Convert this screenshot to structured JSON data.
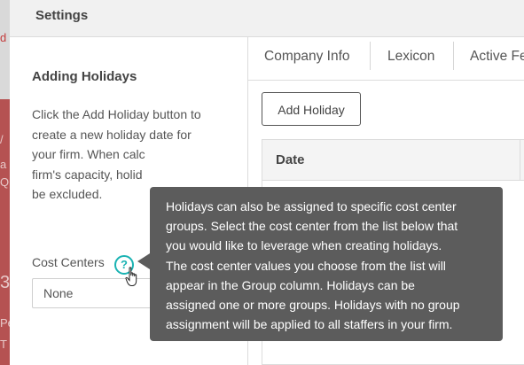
{
  "background": {
    "fragments": [
      "d",
      "/",
      "a",
      "Q",
      "3",
      "Pe",
      "T"
    ]
  },
  "panel": {
    "title": "Settings"
  },
  "left": {
    "section_title": "Adding Holidays",
    "description_lines": [
      "Click the Add Holiday button to",
      "create a new holiday date for",
      "your firm. When calc",
      "firm's capacity, holid",
      "be excluded."
    ],
    "cost_centers_label": "Cost Centers",
    "help_icon_glyph": "?",
    "cost_center_select_value": "None"
  },
  "tabs": [
    {
      "label": "Company Info"
    },
    {
      "label": "Lexicon"
    },
    {
      "label": "Active Fe"
    }
  ],
  "toolbar": {
    "add_holiday_label": "Add Holiday"
  },
  "table": {
    "columns": [
      "Date"
    ]
  },
  "tooltip": {
    "lines": [
      "Holidays can also be assigned to specific cost center",
      "groups. Select the cost center from the list below that",
      "you would like to leverage when creating holidays.",
      "The cost center values you choose from the list will",
      "appear in the Group column. Holidays can be",
      "assigned one or more groups. Holidays with no group",
      "assignment will be applied to all staffers in your firm."
    ]
  },
  "colors": {
    "accent": "#1ab3b3",
    "tooltip_bg": "#5c5c5c",
    "background_red": "#b55252"
  },
  "icons": {
    "help": "question-circle-icon",
    "cursor": "hand-pointer-icon"
  }
}
